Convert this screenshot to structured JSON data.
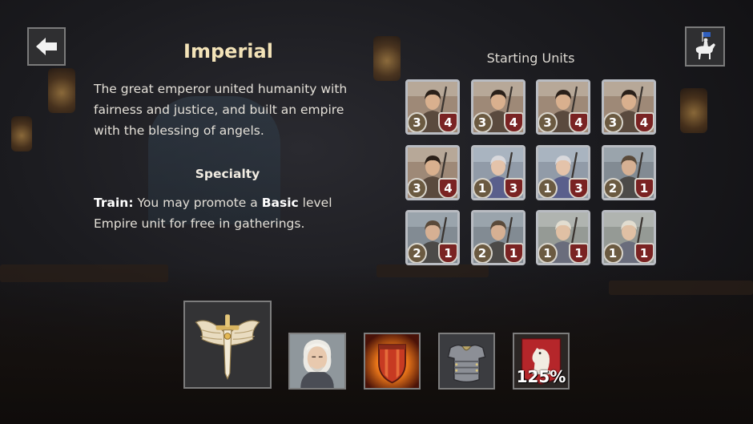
{
  "screen": {
    "faction_title": "Imperial",
    "description": "The great emperor united humanity with fairness and justice, and built an empire with the blessing of angels.",
    "specialty": {
      "heading": "Specialty",
      "label": "Train:",
      "text_before": " You may promote a ",
      "keyword": "Basic",
      "text_after": " level Empire unit for free in gatherings."
    },
    "units_title": "Starting Units"
  },
  "icons": {
    "back": "left-arrow-icon",
    "hero_preview": "mounted-knight-icon",
    "faction_emblem": "winged-sword-emblem-icon"
  },
  "units": [
    {
      "type": "swordsman",
      "attack": "3",
      "defense": "4"
    },
    {
      "type": "swordsman",
      "attack": "3",
      "defense": "4"
    },
    {
      "type": "swordsman",
      "attack": "3",
      "defense": "4"
    },
    {
      "type": "swordsman",
      "attack": "3",
      "defense": "4"
    },
    {
      "type": "swordsman",
      "attack": "3",
      "defense": "4"
    },
    {
      "type": "priestess",
      "attack": "1",
      "defense": "3"
    },
    {
      "type": "priestess",
      "attack": "1",
      "defense": "3"
    },
    {
      "type": "crossbowman",
      "attack": "2",
      "defense": "1"
    },
    {
      "type": "crossbowman",
      "attack": "2",
      "defense": "1"
    },
    {
      "type": "crossbowman",
      "attack": "2",
      "defense": "1"
    },
    {
      "type": "elder",
      "attack": "1",
      "defense": "1"
    },
    {
      "type": "elder",
      "attack": "1",
      "defense": "1"
    }
  ],
  "bonuses": {
    "commander": "white-haired-commander-portrait",
    "fire_shield": "fire-shield-icon",
    "armor": "plate-armor-icon",
    "cavalry_banner": {
      "icon": "knight-chess-banner-icon",
      "percent": "125%"
    }
  },
  "colors": {
    "title_gold": "#f3e3b8",
    "attack_badge": "#6b5a41",
    "defense_badge": "#7a2323",
    "card_border": "#b9bcc2"
  }
}
